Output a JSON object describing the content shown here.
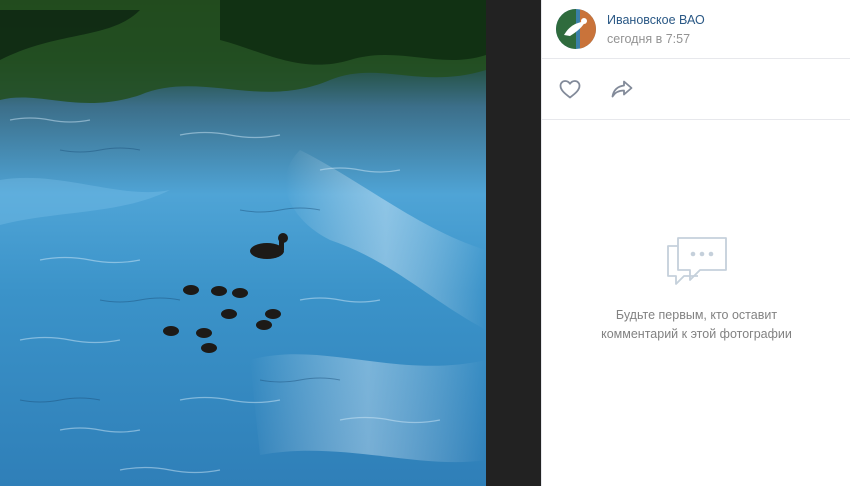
{
  "author": {
    "name": "Ивановское ВАО",
    "time": "сегодня в 7:57"
  },
  "actions": {
    "like_icon": "heart-icon",
    "share_icon": "share-arrow-icon"
  },
  "comments": {
    "empty_icon": "speech-bubbles-icon",
    "empty_line1": "Будьте первым, кто оставит",
    "empty_line2": "комментарий к этой фотографии"
  },
  "colors": {
    "link": "#2a5885",
    "muted": "#939393",
    "icon": "#828a99"
  }
}
